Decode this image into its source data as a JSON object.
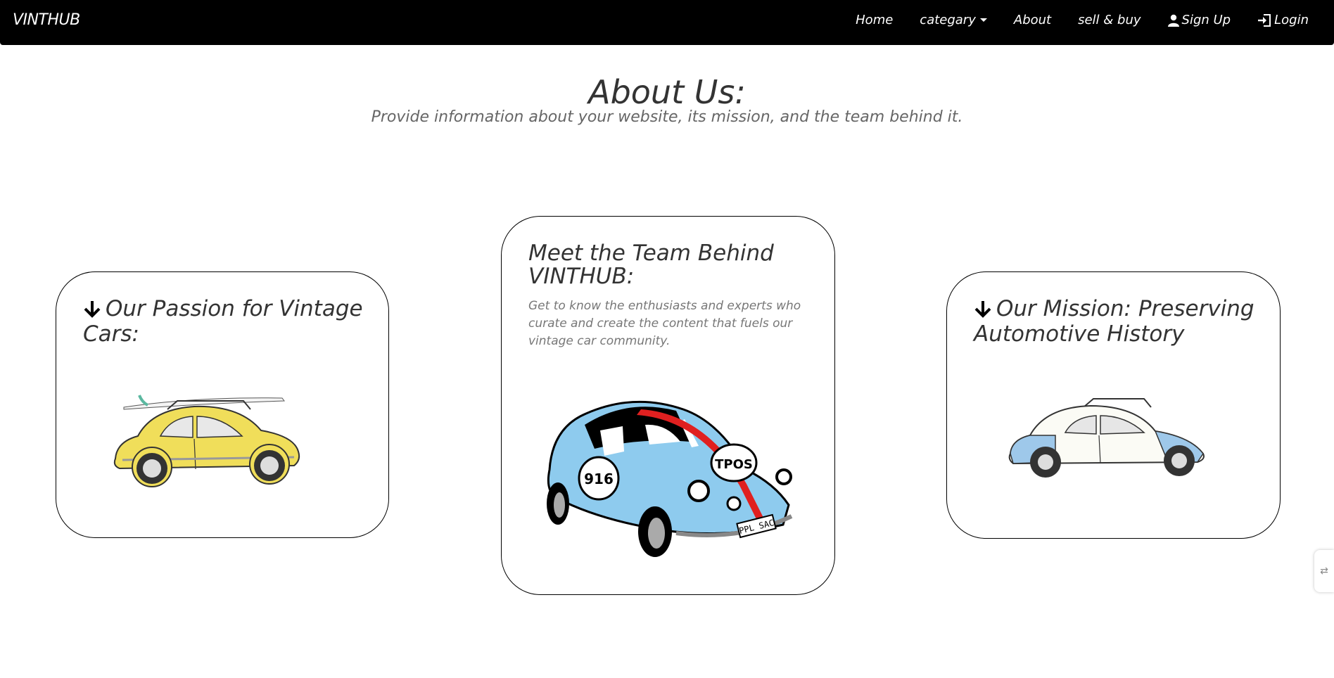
{
  "nav": {
    "brand": "VINTHUB",
    "home": "Home",
    "category": "categary",
    "about": "About",
    "sell_buy": "sell & buy",
    "signup": "Sign Up",
    "login": "Login"
  },
  "header": {
    "title": "About Us:",
    "subtitle": "Provide information about your website, its mission, and the team behind it."
  },
  "cards": {
    "passion": {
      "title": "Our Passion for Vintage Cars:"
    },
    "team": {
      "title": "Meet the Team Behind VINTHUB:",
      "text": "Get to know the enthusiasts and experts who curate and create the content that fuels our vintage car community."
    },
    "mission": {
      "title": "Our Mission: Preserving Automotive History"
    }
  },
  "car_labels": {
    "left_number": "916",
    "right_badge": "TPOS",
    "plate": "PPL SAC"
  },
  "colors": {
    "navbar": "#000000",
    "yellow_car": "#f0de5a",
    "blue_car": "#8ecbee",
    "stripe": "#e02020"
  },
  "icons": {
    "signup": "user-icon",
    "login": "login-icon",
    "card_arrow": "arrow-down-icon"
  }
}
